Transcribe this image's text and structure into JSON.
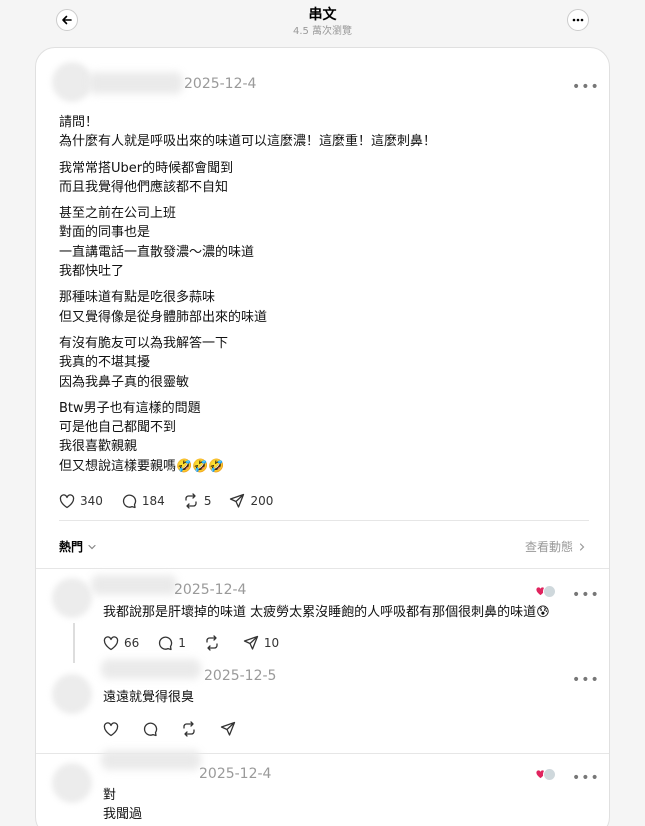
{
  "header": {
    "title": "串文",
    "views": "4.5 萬次瀏覽"
  },
  "post": {
    "date": "2025-12-4",
    "paragraphs": [
      "請問！\n為什麼有人就是呼吸出來的味道可以這麼濃！這麼重！這麼刺鼻！",
      "我常常搭Uber的時候都會聞到\n而且我覺得他們應該都不自知",
      "甚至之前在公司上班\n對面的同事也是\n一直講電話一直散發濃～濃的味道\n我都快吐了",
      "那種味道有點是吃很多蒜味\n但又覺得像是從身體肺部出來的味道",
      "有沒有脆友可以為我解答一下\n我真的不堪其擾\n因為我鼻子真的很靈敏",
      "Btw男子也有這樣的問題\n可是他自己都聞不到\n我很喜歡親親\n但又想說這樣要親嗎🤣🤣🤣"
    ],
    "likes": "340",
    "comments": "184",
    "reposts": "5",
    "shares": "200"
  },
  "sort": {
    "label": "熱門",
    "activity": "查看動態"
  },
  "replies": [
    {
      "date": "2025-12-4",
      "text": "我都說那是肝壞掉的味道 太疲勞太累沒睡飽的人呼吸都有那個很刺鼻的味道😰",
      "likes": "66",
      "comments": "1",
      "shares": "10"
    },
    {
      "date": "2025-12-5",
      "text": "遠遠就覺得很臭",
      "likes": "",
      "comments": "",
      "shares": ""
    },
    {
      "date": "2025-12-4",
      "text": "對\n我聞過"
    }
  ],
  "colors": {
    "accent_heart": "#e0245e",
    "muted": "#9a9a9a"
  }
}
